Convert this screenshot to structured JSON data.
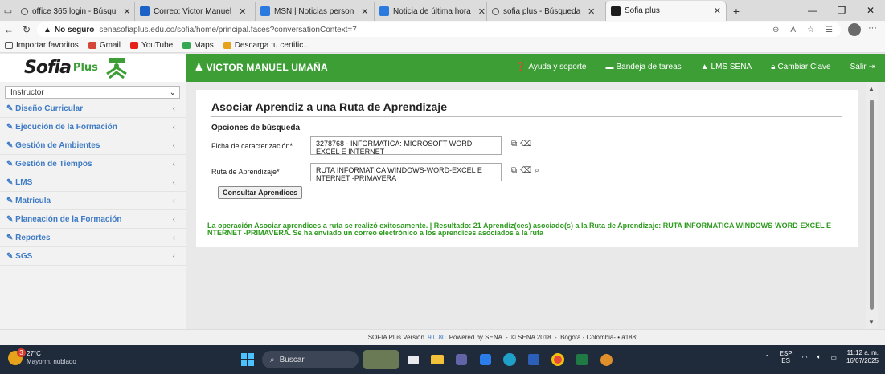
{
  "browser": {
    "tabs": [
      {
        "title": "office 365 login - Búsqu",
        "favicon_color": "#4a4a4a"
      },
      {
        "title": "Correo: Victor Manuel",
        "favicon_color": "#1b63c6"
      },
      {
        "title": "MSN | Noticias person",
        "favicon_color": "#2a7ae0"
      },
      {
        "title": "Noticia de última hora",
        "favicon_color": "#2a7ae0"
      },
      {
        "title": "sofia plus - Búsqueda",
        "favicon_color": "#4a4a4a"
      },
      {
        "title": "Sofia plus",
        "favicon_color": "#3c9e35"
      }
    ],
    "address": {
      "security_label": "No seguro",
      "url": "senasofiaplus.edu.co/sofia/home/principal.faces?conversationContext=7"
    },
    "bookmarks": [
      {
        "label": "Importar favoritos",
        "icon": "import-icon",
        "color": "#555"
      },
      {
        "label": "Gmail",
        "icon": "gmail-icon",
        "color": "#d44638"
      },
      {
        "label": "YouTube",
        "icon": "youtube-icon",
        "color": "#e62117"
      },
      {
        "label": "Maps",
        "icon": "maps-icon",
        "color": "#34a853"
      },
      {
        "label": "Descarga tu certific...",
        "icon": "certificate-icon",
        "color": "#e6a21a"
      }
    ]
  },
  "header": {
    "logo_text": "Sofia",
    "logo_plus": "Plus",
    "user_name": "VICTOR MANUEL UMAÑA",
    "links": [
      {
        "icon": "help-icon",
        "label": "Ayuda y soporte"
      },
      {
        "icon": "tasks-icon",
        "label": "Bandeja de tareas"
      },
      {
        "icon": "graduation-icon",
        "label": "LMS SENA"
      },
      {
        "icon": "lock-icon",
        "label": "Cambiar Clave"
      },
      {
        "icon": "exit-icon",
        "label": "Salir"
      }
    ],
    "accent": "#3c9e35"
  },
  "sidebar": {
    "role": "Instructor",
    "items": [
      {
        "label": "Diseño Curricular"
      },
      {
        "label": "Ejecución de la Formación"
      },
      {
        "label": "Gestión de Ambientes"
      },
      {
        "label": "Gestión de Tiempos"
      },
      {
        "label": "LMS"
      },
      {
        "label": "Matrícula"
      },
      {
        "label": "Planeación de la Formación"
      },
      {
        "label": "Reportes"
      },
      {
        "label": "SGS"
      }
    ]
  },
  "main": {
    "title": "Asociar Aprendiz a una Ruta de Aprendizaje",
    "subtitle": "Opciones de búsqueda",
    "ficha": {
      "label": "Ficha de caracterización",
      "required": "*",
      "value": "3278768 - INFORMATICA: MICROSOFT WORD, EXCEL E INTERNET"
    },
    "ruta": {
      "label": "Ruta de Aprendizaje",
      "required": "*",
      "value": "RUTA INFORMATICA WINDOWS-WORD-EXCEL E NTERNET -PRIMAVERA"
    },
    "consult_button": "Consultar Aprendices",
    "success_message": "La operación Asociar aprendices a ruta se realizó exitosamente. | Resultado: 21 Aprendiz(ces) asociado(s) a la Ruta de Aprendizaje: RUTA INFORMATICA WINDOWS-WORD-EXCEL E NTERNET -PRIMAVERA. Se ha enviado un correo electrónico a los aprendices asociados a la ruta",
    "success_color": "#2d9b1e"
  },
  "footer": {
    "prefix": "SOFIA Plus Versión",
    "version": "9.0.80",
    "suffix": "Powered by SENA .-. © SENA 2018 .-. Bogotá - Colombia- •.a188;"
  },
  "taskbar": {
    "temperature": "27°C",
    "weather": "Mayorm. nublado",
    "notifications": "3",
    "search_placeholder": "Buscar",
    "language": "ESP",
    "language_sub": "ES",
    "time": "11:12 a. m.",
    "date": "16/07/2025"
  }
}
